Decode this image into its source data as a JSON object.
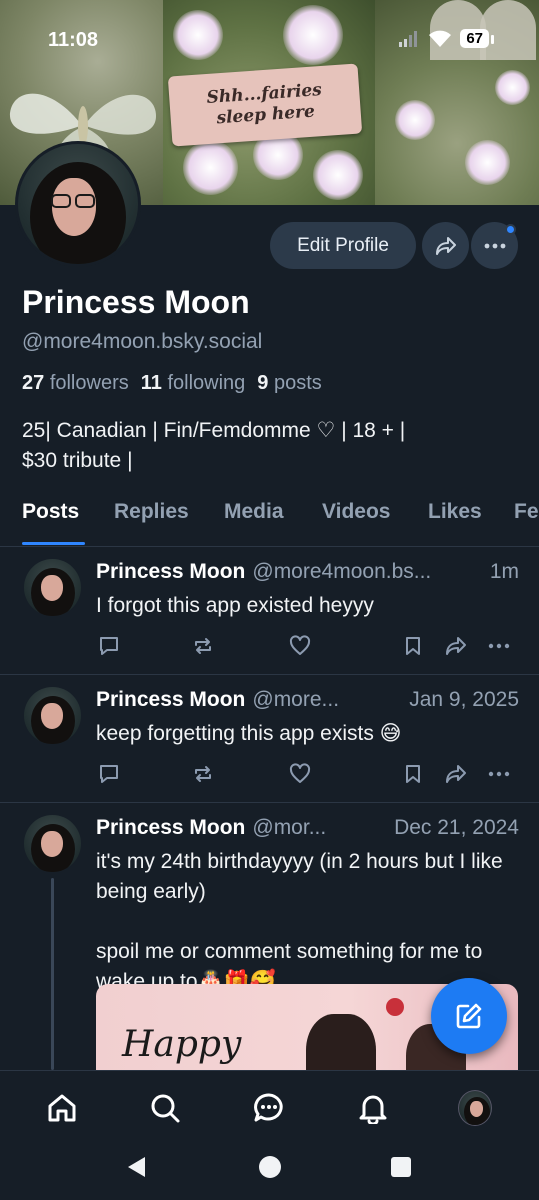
{
  "status_bar": {
    "time": "11:08",
    "battery": "67",
    "icons": [
      "signal-icon",
      "wifi-icon",
      "battery-icon"
    ]
  },
  "banner": {
    "sign_text": "Shh...fairies sleep here"
  },
  "profile": {
    "display_name": "Princess Moon",
    "handle": "@more4moon.bsky.social",
    "followers_count": "27",
    "followers_label": "followers",
    "following_count": "11",
    "following_label": "following",
    "posts_count": "9",
    "posts_label": "posts",
    "bio_line1": "25| Canadian | Fin/Femdomme ♡ | 18 + |",
    "bio_line2": "$30 tribute |",
    "edit_button": "Edit Profile",
    "icons": [
      "share-icon",
      "more-icon"
    ]
  },
  "tabs": [
    {
      "label": "Posts",
      "active": true
    },
    {
      "label": "Replies",
      "active": false
    },
    {
      "label": "Media",
      "active": false
    },
    {
      "label": "Videos",
      "active": false
    },
    {
      "label": "Likes",
      "active": false
    },
    {
      "label": "Fe",
      "active": false
    }
  ],
  "posts": [
    {
      "name": "Princess Moon",
      "handle": "@more4moon.bs...",
      "time": "1m",
      "text": "I forgot this app existed heyyy"
    },
    {
      "name": "Princess Moon",
      "handle": "@more...",
      "time": "Jan 9, 2025",
      "text": "keep forgetting this app exists 😅"
    },
    {
      "name": "Princess Moon",
      "handle": "@mor...",
      "time": "Dec 21, 2024",
      "text": "it's my 24th birthdayyyy (in 2 hours but I like being early)\n\nspoil me or comment something for me to wake up to🎂🎁🥰",
      "image_text": "Happy"
    }
  ],
  "post_action_icons": [
    "reply-icon",
    "repost-icon",
    "like-icon",
    "bookmark-icon",
    "share-icon",
    "more-icon"
  ],
  "compose_icon": "compose-icon",
  "bottom_nav": [
    "home-icon",
    "search-icon",
    "chat-icon",
    "bell-icon",
    "profile-avatar"
  ],
  "system_nav": [
    "back",
    "home",
    "recents"
  ],
  "colors": {
    "background": "#161e27",
    "accent": "#2f86ff",
    "muted_text": "#93a1b2",
    "button_bg": "#2c3a4a",
    "fab": "#1d7bf3"
  }
}
